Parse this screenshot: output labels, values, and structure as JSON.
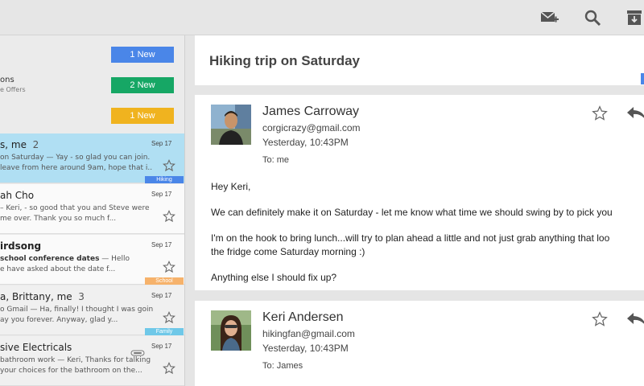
{
  "folders": [
    {
      "name": "",
      "sub": "",
      "badge": "1 New",
      "color": "#4a86e8"
    },
    {
      "name": "ons",
      "sub": "e Offers",
      "badge": "2 New",
      "color": "#16a765"
    },
    {
      "name": "",
      "sub": "",
      "badge": "1 New",
      "color": "#f0b31f"
    }
  ],
  "threads": [
    {
      "sender": "s, me",
      "count": "2",
      "date": "Sep 17",
      "snippet1_bold": "",
      "snippet1": "on Saturday — Yay - so glad you can join.",
      "snippet2": "leave from here around 9am, hope that i...",
      "label": "Hiking",
      "label_color": "#4a86e8"
    },
    {
      "sender": "ah Cho",
      "count": "",
      "date": "Sep 17",
      "snippet1_bold": "",
      "snippet1": "– Keri, - so good that you and Steve were",
      "snippet2": "me over. Thank you so much f...",
      "label": "",
      "label_color": ""
    },
    {
      "sender": "irdsong",
      "count": "",
      "date": "Sep 17",
      "snippet1_bold": "school conference dates",
      "snippet1": " — Hello",
      "snippet2": "e have asked about the date f...",
      "label": "School",
      "label_color": "#f6b26b"
    },
    {
      "sender": "a, Brittany, me",
      "count": "3",
      "date": "Sep 17",
      "snippet1_bold": "",
      "snippet1": "o Gmail — Ha, finally! I thought I was going",
      "snippet2": "ay you forever. Anyway, glad y...",
      "label": "Family",
      "label_color": "#6fc8e8"
    },
    {
      "sender": "sive Electricals",
      "count": "",
      "date": "Sep 17",
      "snippet1_bold": "",
      "snippet1": "bathroom work — Keri, Thanks for talking",
      "snippet2": "your choices for the bathroom on the...",
      "label": "",
      "label_color": ""
    }
  ],
  "conversation": {
    "subject": "Hiking trip on Saturday",
    "messages": [
      {
        "name": "James Carroway",
        "email": "corgicrazy@gmail.com",
        "time": "Yesterday, 10:43PM",
        "to": "To: me",
        "body": [
          "Hey Keri,",
          "We can definitely make it on Saturday - let me know what time we should swing by to pick you",
          "I'm on the hook to bring lunch...will try to plan ahead a little and not just grab anything that loo",
          "the fridge come Saturday morning :)",
          "Anything else I should fix up?"
        ]
      },
      {
        "name": "Keri Andersen",
        "email": "hikingfan@gmail.com",
        "time": "Yesterday, 10:43PM",
        "to": "To: James"
      }
    ]
  },
  "colors": {
    "selected": "#b0dff3",
    "accent": "#4a86e8"
  },
  "icons": [
    "compose-icon",
    "search-icon",
    "archive-icon",
    "star-icon",
    "reply-icon",
    "attachment-icon"
  ]
}
